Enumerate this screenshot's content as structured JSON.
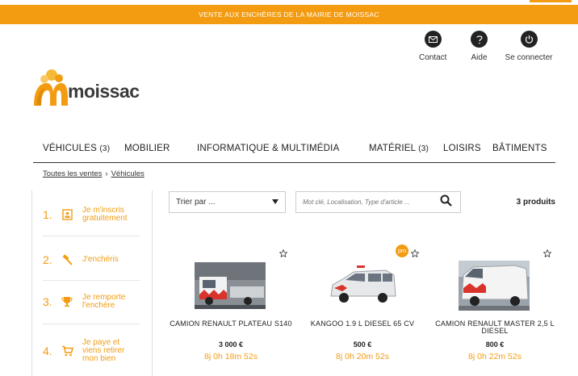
{
  "banner": {
    "text": "VENTE AUX ENCHÈRES DE LA MAIRIE DE MOISSAC"
  },
  "utility": [
    {
      "label": "Contact",
      "icon": "envelope-icon"
    },
    {
      "label": "Aide",
      "icon": "question-icon"
    },
    {
      "label": "Se connecter",
      "icon": "power-icon"
    }
  ],
  "logo": {
    "text": "moissac"
  },
  "nav": [
    {
      "label": "VÉHICULES",
      "count": "(3)"
    },
    {
      "label": "MOBILIER",
      "count": ""
    },
    {
      "label": "INFORMATIQUE & MULTIMÉDIA",
      "count": ""
    },
    {
      "label": "MATÉRIEL",
      "count": "(3)"
    },
    {
      "label": "LOISIRS",
      "count": ""
    },
    {
      "label": "BÂTIMENTS",
      "count": ""
    }
  ],
  "breadcrumb": {
    "home": "Toutes les ventes",
    "separator": "›",
    "current": "Véhicules"
  },
  "steps": [
    {
      "num": "1.",
      "text": "Je m'inscris gratuitement",
      "icon": "id-card-icon"
    },
    {
      "num": "2.",
      "text": "J'enchéris",
      "icon": "gavel-icon"
    },
    {
      "num": "3.",
      "text": "Je remporte l'enchère",
      "icon": "trophy-icon"
    },
    {
      "num": "4.",
      "text": "Je paye et viens retirer mon bien",
      "icon": "cart-icon"
    }
  ],
  "toolbar": {
    "sort_label": "Trier par ...",
    "search_placeholder": "Mot clé, Localisation, Type d'article ...",
    "count": "3 produits"
  },
  "products": [
    {
      "title": "CAMION RENAULT PLATEAU S140",
      "price": "3 000 €",
      "timer": "8j 0h 18m 52s",
      "pro": ""
    },
    {
      "title": "KANGOO 1.9 L DIESEL 65 CV",
      "price": "500 €",
      "timer": "8j 0h 20m 52s",
      "pro": "pro"
    },
    {
      "title": "CAMION RENAULT MASTER 2,5 L DIESEL",
      "price": "800 €",
      "timer": "8j 0h 22m 52s",
      "pro": ""
    }
  ],
  "colors": {
    "accent": "#f39c12",
    "dark": "#222222"
  }
}
